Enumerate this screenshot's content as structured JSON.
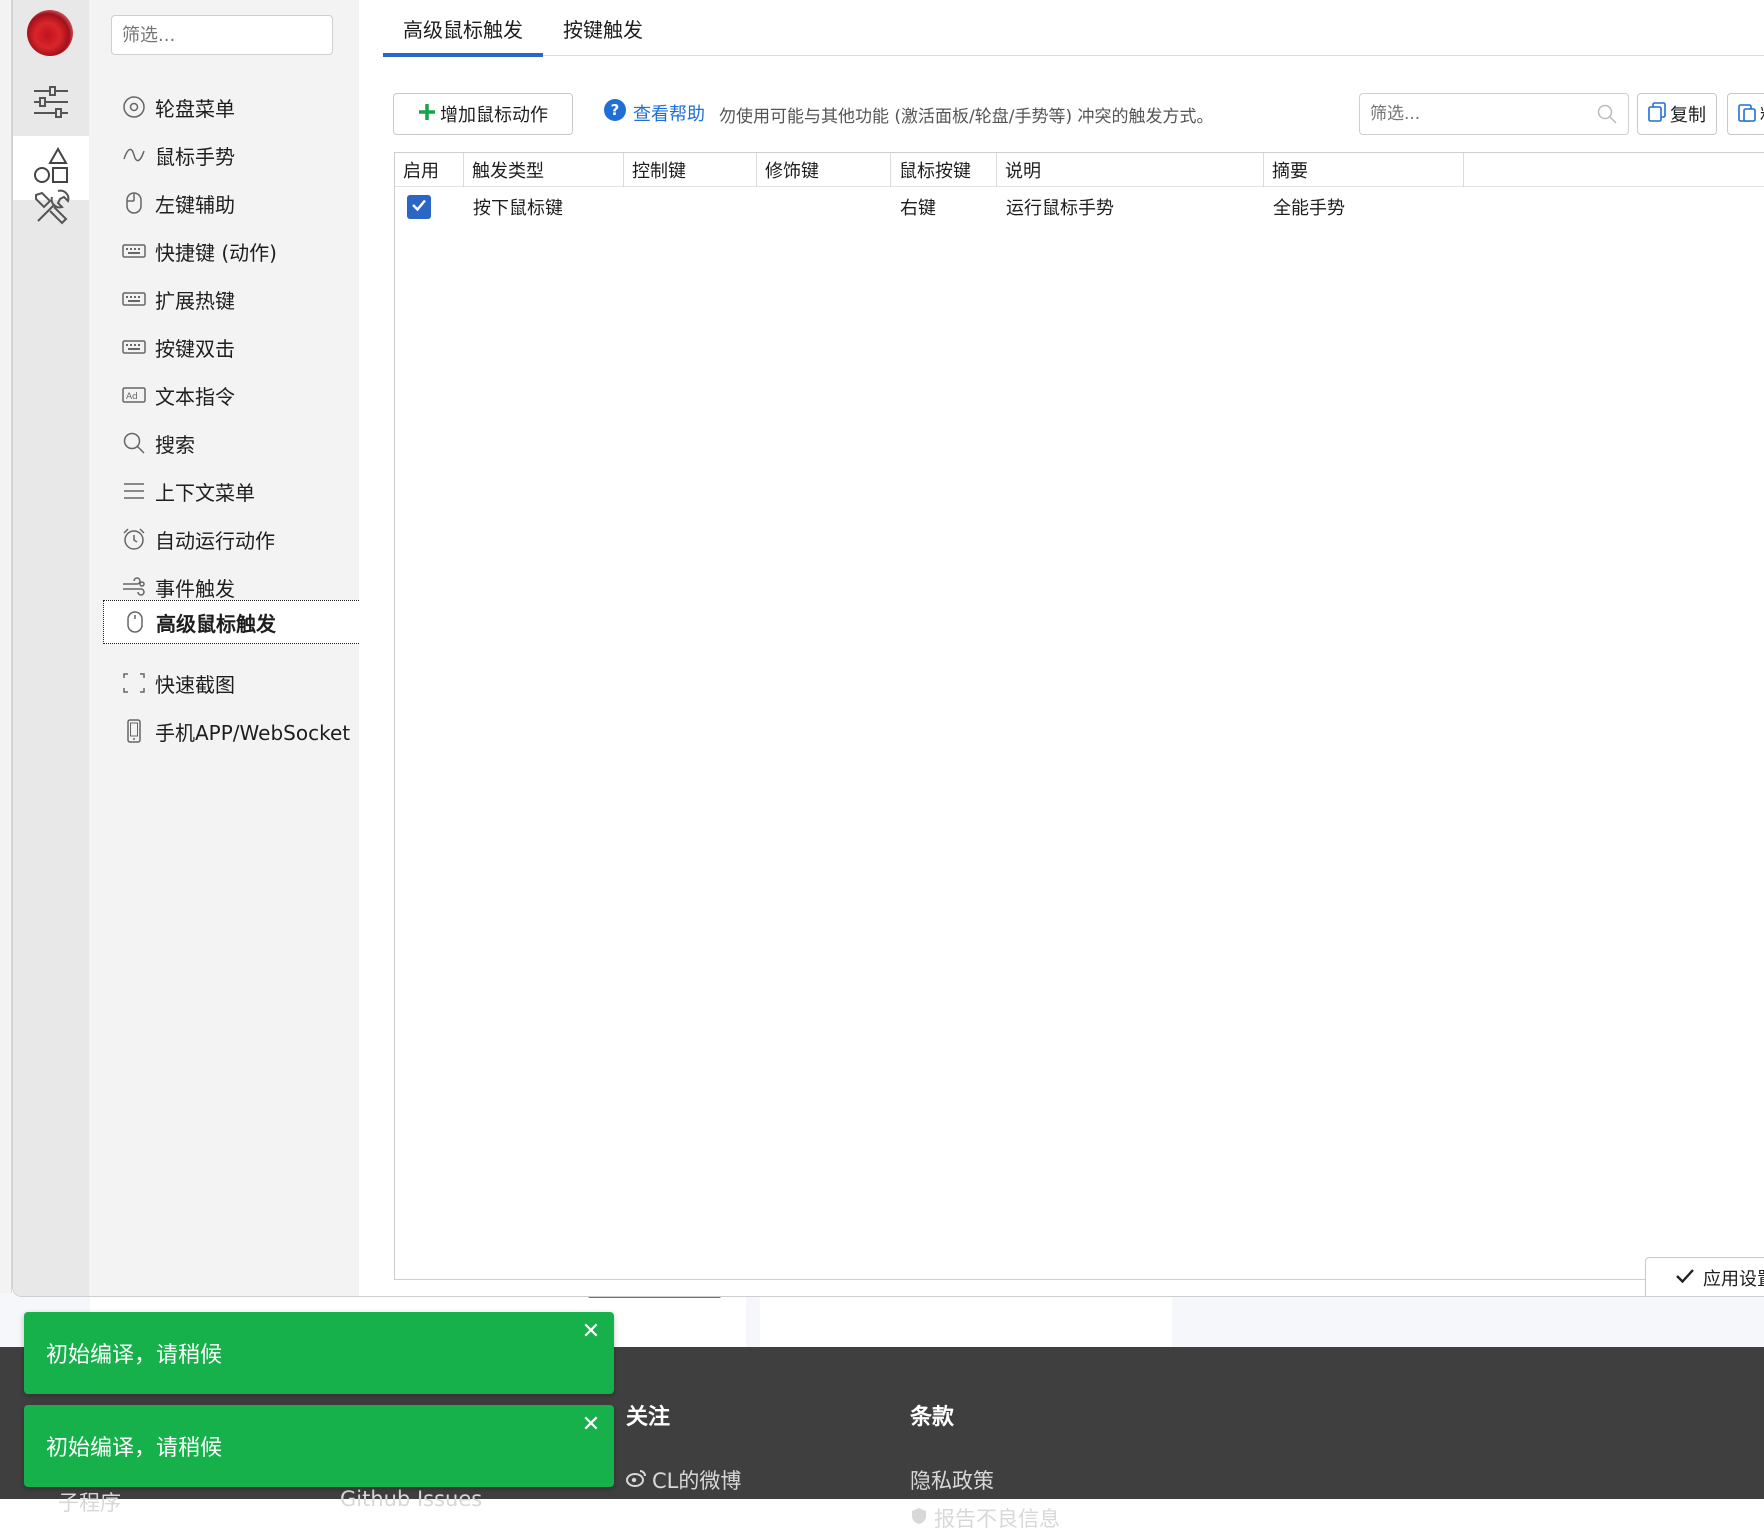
{
  "nav": {
    "filter_placeholder": "筛选...",
    "items": [
      {
        "label": "轮盘菜单",
        "icon": "radio-circle-icon"
      },
      {
        "label": "鼠标手势",
        "icon": "gesture-wave-icon"
      },
      {
        "label": "左键辅助",
        "icon": "mouse-left-icon"
      },
      {
        "label": "快捷键 (动作)",
        "icon": "keyboard-icon"
      },
      {
        "label": "扩展热键",
        "icon": "keyboard-icon"
      },
      {
        "label": "按键双击",
        "icon": "keyboard-icon"
      },
      {
        "label": "文本指令",
        "icon": "ad-text-icon"
      },
      {
        "label": "搜索",
        "icon": "search-icon"
      },
      {
        "label": "上下文菜单",
        "icon": "hamburger-menu-icon"
      },
      {
        "label": "自动运行动作",
        "icon": "alarm-clock-icon"
      },
      {
        "label": "事件触发",
        "icon": "wind-icon"
      },
      {
        "label": "高级鼠标触发",
        "icon": "mouse-icon",
        "selected": true
      },
      {
        "label": "快速截图",
        "icon": "screenshot-frame-icon"
      },
      {
        "label": "手机APP/WebSocket",
        "icon": "phone-icon"
      }
    ]
  },
  "rail": {
    "items": [
      "sliders-icon",
      "shapes-icon",
      "tools-icon"
    ],
    "active_index": 1
  },
  "tabs": [
    {
      "label": "高级鼠标触发",
      "active": true
    },
    {
      "label": "按键触发",
      "active": false
    }
  ],
  "toolbar": {
    "add_button": "增加鼠标动作",
    "help_link": "查看帮助",
    "help_note": "勿使用可能与其他功能 (激活面板/轮盘/手势等) 冲突的触发方式。",
    "filter_placeholder": "筛选...",
    "copy_button": "复制",
    "paste_button": "粘"
  },
  "table": {
    "columns": [
      "启用",
      "触发类型",
      "控制键",
      "修饰键",
      "鼠标按键",
      "说明",
      "摘要"
    ],
    "rows": [
      {
        "enabled": true,
        "trigger_type": "按下鼠标键",
        "control_key": "",
        "modifier_key": "",
        "mouse_button": "右键",
        "description": "运行鼠标手势",
        "summary": "全能手势"
      }
    ]
  },
  "apply_button": "应用设置",
  "toasts": [
    {
      "text": "初始编译，请稍候"
    },
    {
      "text": "初始编译，请稍候"
    }
  ],
  "footer": {
    "follow_heading": "关注",
    "follow_link": "CL的微博",
    "terms_heading": "条款",
    "terms_link": "隐私政策",
    "terms_link2": "报告不良信息",
    "partial_left": "子程序",
    "partial_mid": "Github Issues"
  },
  "colors": {
    "accent": "#2b66c7",
    "toast_green": "#16b14b",
    "footer_bg": "#3f3f3f",
    "rail_bg": "#e8e8e8",
    "nav_bg": "#f3f3f3"
  }
}
